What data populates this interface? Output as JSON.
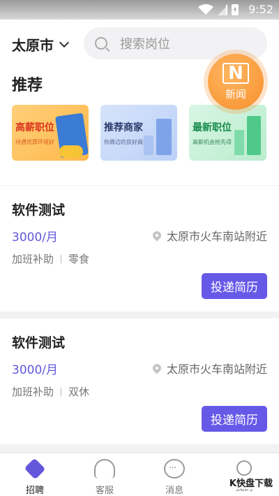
{
  "status_bar": {
    "time": "9:52"
  },
  "header": {
    "city": "太原市",
    "search_placeholder": "搜索岗位"
  },
  "recommend": {
    "title": "推荐",
    "news_badge": {
      "letter": "N",
      "label": "新闻"
    },
    "cards": [
      {
        "title": "高薪职位",
        "subtitle": "待遇优厚环境好"
      },
      {
        "title": "推荐商家",
        "subtitle": "你周边的良好商家"
      },
      {
        "title": "最新职位",
        "subtitle": "高薪机会抢先得"
      }
    ]
  },
  "jobs": [
    {
      "title": "软件测试",
      "salary": "3000/月",
      "location": "太原市火车南站附近",
      "tags": [
        "加班补助",
        "零食"
      ],
      "apply_label": "投递简历"
    },
    {
      "title": "软件测试",
      "salary": "3000/月",
      "location": "太原市火车南站附近",
      "tags": [
        "加班补助",
        "双休"
      ],
      "apply_label": "投递简历"
    }
  ],
  "tabbar": {
    "items": [
      {
        "label": "招聘",
        "icon": "handshake-icon",
        "active": true
      },
      {
        "label": "客服",
        "icon": "headset-icon",
        "active": false
      },
      {
        "label": "消息",
        "icon": "chat-icon",
        "active": false
      },
      {
        "label": "我的",
        "icon": "user-icon",
        "active": false
      }
    ]
  },
  "watermark": {
    "text": "K快盘下载"
  },
  "colors": {
    "accent": "#6759e8",
    "salary": "#6358dc",
    "badge": "#f7902d"
  }
}
